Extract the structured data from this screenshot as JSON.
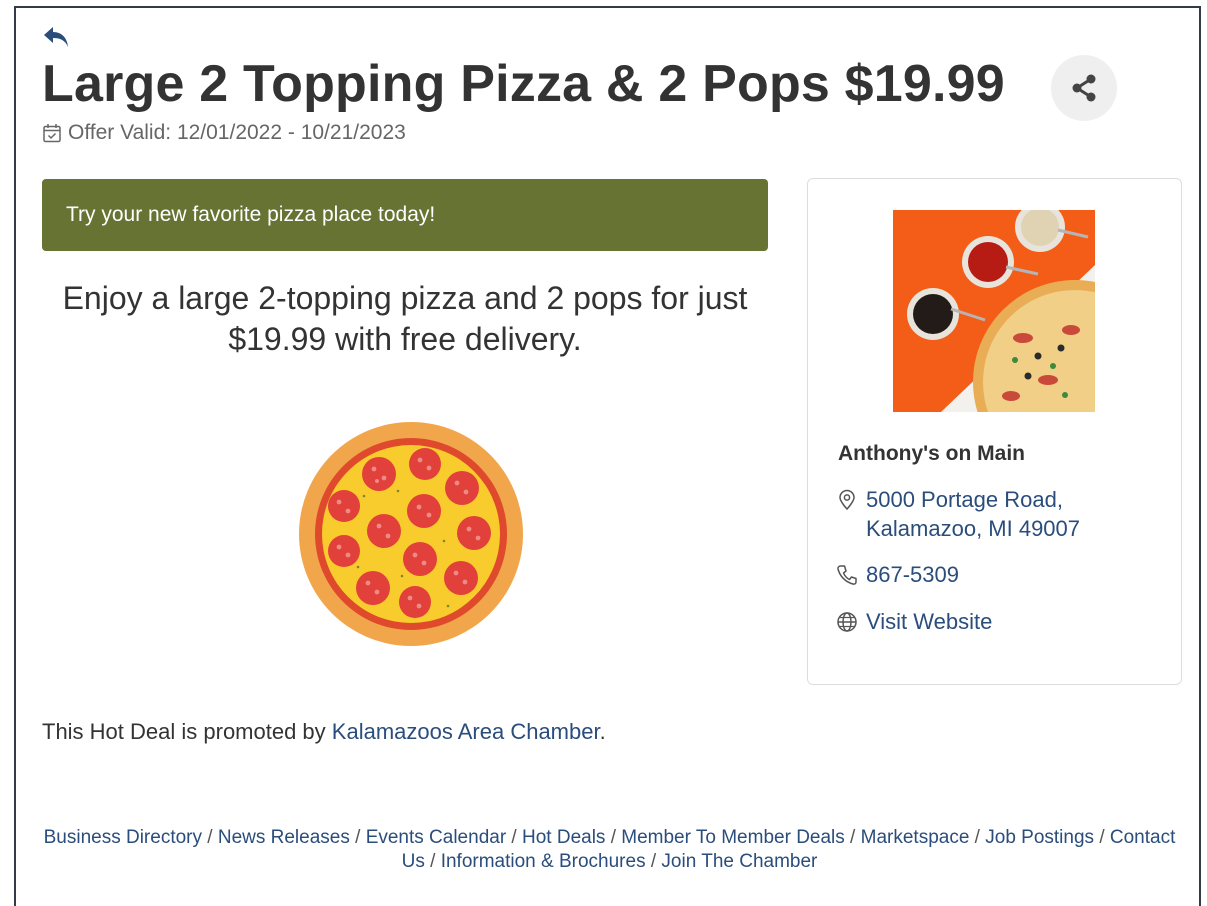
{
  "deal": {
    "title": "Large 2 Topping Pizza & 2 Pops $19.99",
    "valid_label": "Offer Valid: 12/01/2022 - 10/21/2023",
    "banner": "Try your new favorite pizza place today!",
    "description": "Enjoy a large 2-topping pizza and 2 pops for just $19.99 with free delivery."
  },
  "icons": {
    "back": "back-arrow-icon",
    "share": "share-icon",
    "calendar": "calendar-check-icon",
    "location": "map-pin-icon",
    "phone": "phone-icon",
    "web": "globe-icon"
  },
  "business": {
    "name": "Anthony's on Main",
    "address_line1": "5000 Portage Road,",
    "address_line2": "Kalamazoo, MI 49007",
    "phone": "867-5309",
    "website_label": "Visit Website"
  },
  "promoted": {
    "prefix": "This Hot Deal is promoted by ",
    "org": "Kalamazoos Area Chamber",
    "suffix": "."
  },
  "footer": {
    "sep": " / ",
    "links": [
      "Business Directory",
      "News Releases",
      "Events Calendar",
      "Hot Deals",
      "Member To Member Deals",
      "Marketspace",
      "Job Postings",
      "Contact Us",
      "Information & Brochures",
      "Join The Chamber"
    ]
  },
  "colors": {
    "banner_bg": "#667333",
    "link": "#2a4d7c",
    "title": "#333333",
    "share_bg": "#efefef"
  }
}
